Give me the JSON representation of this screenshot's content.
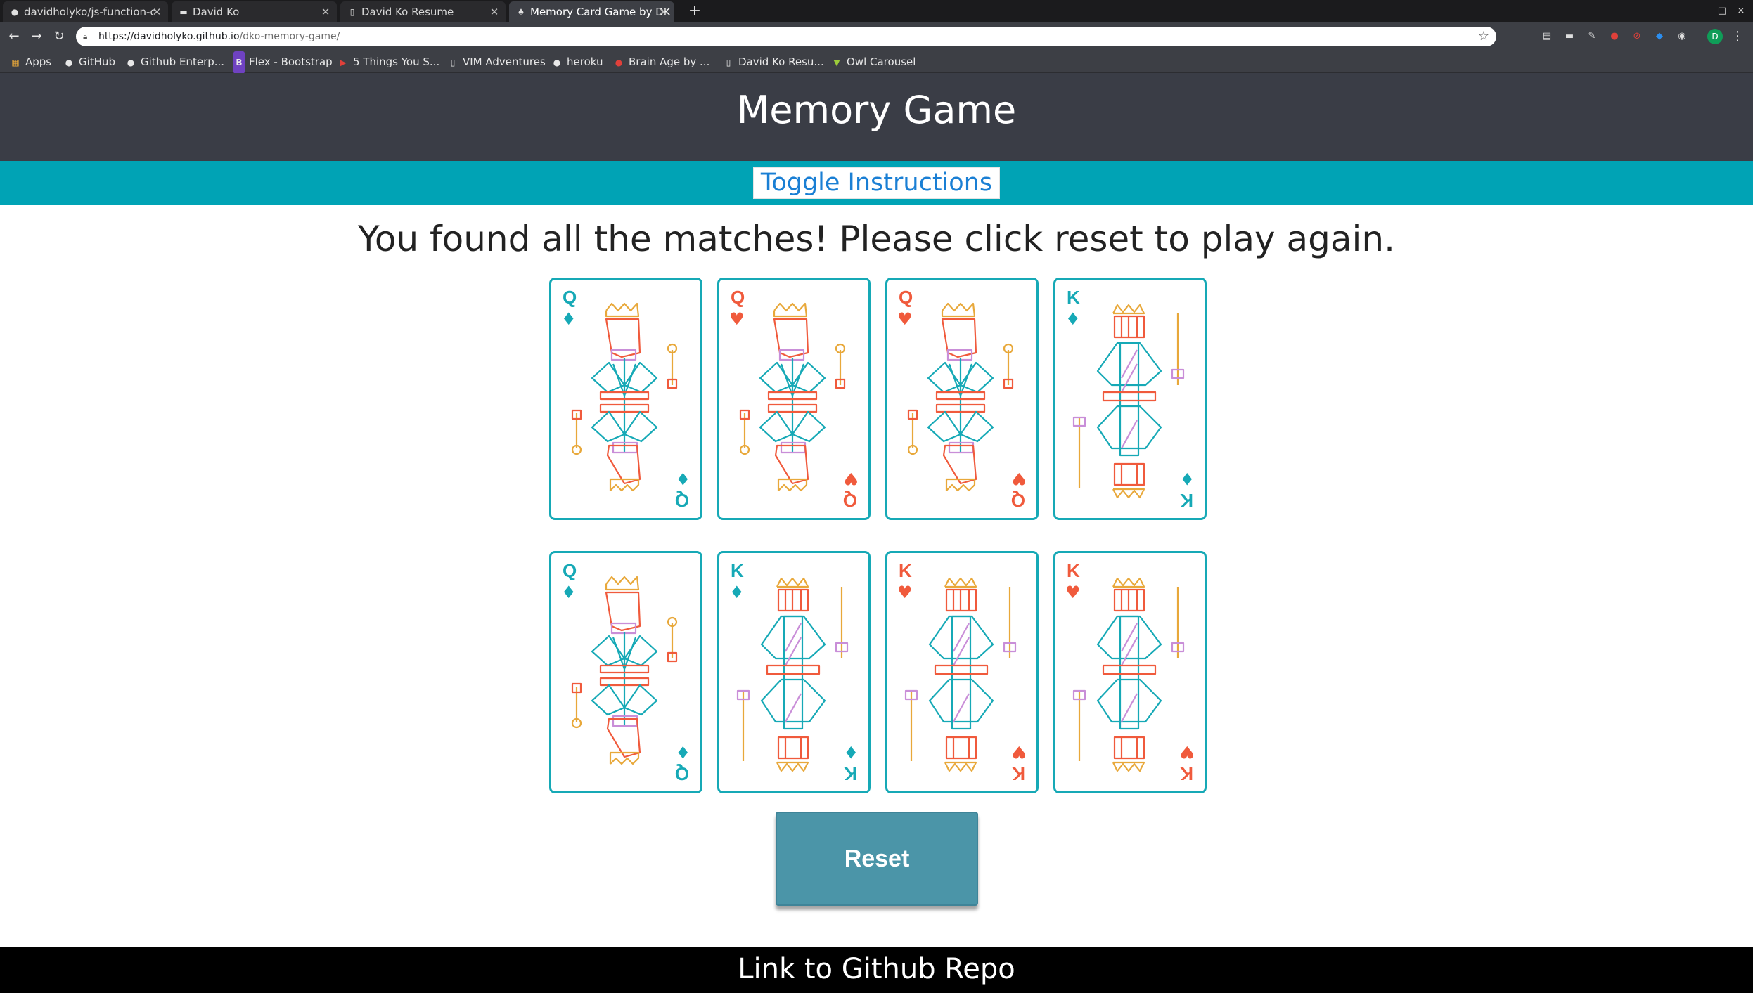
{
  "browser": {
    "tabs": [
      {
        "label": "davidholyko/js-function-c",
        "icon": "github-icon",
        "active": false
      },
      {
        "label": "David Ko",
        "icon": "site-icon",
        "active": false
      },
      {
        "label": "David Ko Resume",
        "icon": "page-icon",
        "active": false
      },
      {
        "label": "Memory Card Game by DK",
        "icon": "spade-icon",
        "active": true
      }
    ],
    "new_tab": "+",
    "window_controls": [
      "–",
      "□",
      "×"
    ],
    "url": {
      "host": "https://davidholyko.github.io",
      "path": "/dko-memory-game/"
    },
    "bookmarks": [
      {
        "label": "Apps",
        "icon": "apps-grid-icon"
      },
      {
        "label": "GitHub",
        "icon": "github-icon"
      },
      {
        "label": "Github Enterp...",
        "icon": "github-icon"
      },
      {
        "label": "Flex - Bootstrap",
        "icon": "bootstrap-icon"
      },
      {
        "label": "5 Things You S...",
        "icon": "youtube-icon"
      },
      {
        "label": "VIM Adventures",
        "icon": "page-icon"
      },
      {
        "label": "heroku",
        "icon": "github-icon"
      },
      {
        "label": "Brain Age by ...",
        "icon": "red-brain-icon"
      },
      {
        "label": "David Ko Resu...",
        "icon": "page-icon"
      },
      {
        "label": "Owl Carousel",
        "icon": "owl-icon"
      }
    ],
    "profile_initial": "D"
  },
  "page": {
    "title": "Memory Game",
    "toggle_label": "Toggle Instructions",
    "message": "You found all the matches! Please click reset to play again.",
    "reset_label": "Reset",
    "footer_link": "Link to Github Repo"
  },
  "colors": {
    "teal": "#16a9b6",
    "red": "#f05a3c",
    "gold": "#e8a83a",
    "lavender": "#c98ed8",
    "header_bg": "#3a3d46",
    "bar_bg": "#00a3b5",
    "reset_bg": "#4b95a8"
  },
  "cards": [
    {
      "rank": "Q",
      "suit": "♦",
      "suit_name": "diamond",
      "rank_color": "teal"
    },
    {
      "rank": "Q",
      "suit": "♥",
      "suit_name": "heart",
      "rank_color": "red"
    },
    {
      "rank": "Q",
      "suit": "♥",
      "suit_name": "heart",
      "rank_color": "red"
    },
    {
      "rank": "K",
      "suit": "♦",
      "suit_name": "diamond",
      "rank_color": "teal"
    },
    {
      "rank": "Q",
      "suit": "♦",
      "suit_name": "diamond",
      "rank_color": "teal"
    },
    {
      "rank": "K",
      "suit": "♦",
      "suit_name": "diamond",
      "rank_color": "teal"
    },
    {
      "rank": "K",
      "suit": "♥",
      "suit_name": "heart",
      "rank_color": "red"
    },
    {
      "rank": "K",
      "suit": "♥",
      "suit_name": "heart",
      "rank_color": "red"
    }
  ]
}
